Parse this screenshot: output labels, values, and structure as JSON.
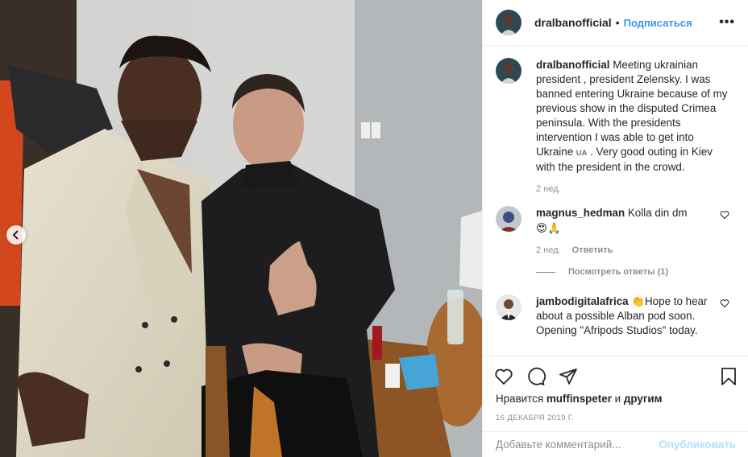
{
  "post": {
    "username": "dralbanofficial",
    "separator": "•",
    "follow_label": "Подписаться",
    "more_label": "•••"
  },
  "caption": {
    "username": "dralbanofficial",
    "text_before_flag": " Meeting ukrainian president , president Zelensky. I was banned entering Ukraine because of my previous show in the disputed Crimea peninsula. With the presidents intervention I was able to get into Ukraine ",
    "flag": "UA",
    "text_after_flag": " . Very good outing in Kiev with the president in the crowd.",
    "time": "2 нед."
  },
  "comments": [
    {
      "username": "magnus_hedman",
      "text": " Kolla din dm",
      "emojis": "😍🙏",
      "time": "2 нед.",
      "reply_label": "Ответить",
      "view_replies": "Посмотреть ответы (1)"
    },
    {
      "username": "jambodigitalafrica",
      "emoji": "👏",
      "text": "Hope to hear about a possible Alban pod soon. Opening \"Afripods Studios\" today."
    }
  ],
  "likes": {
    "prefix": "Нравится",
    "user": "muffinspeter",
    "and": "и",
    "others": "другим"
  },
  "date": "16 ДЕКАБРЯ 2019 Г.",
  "add_comment": {
    "placeholder": "Добавьте комментарий...",
    "publish_label": "Опубликовать"
  },
  "icons": {
    "nav": "chevron-left-icon",
    "like": "heart-icon",
    "comment": "comment-icon",
    "share": "paper-plane-icon",
    "save": "bookmark-icon"
  },
  "colors": {
    "link": "#3897f0",
    "muted": "#8e8e8e",
    "publish_disabled": "#b2dffc"
  }
}
